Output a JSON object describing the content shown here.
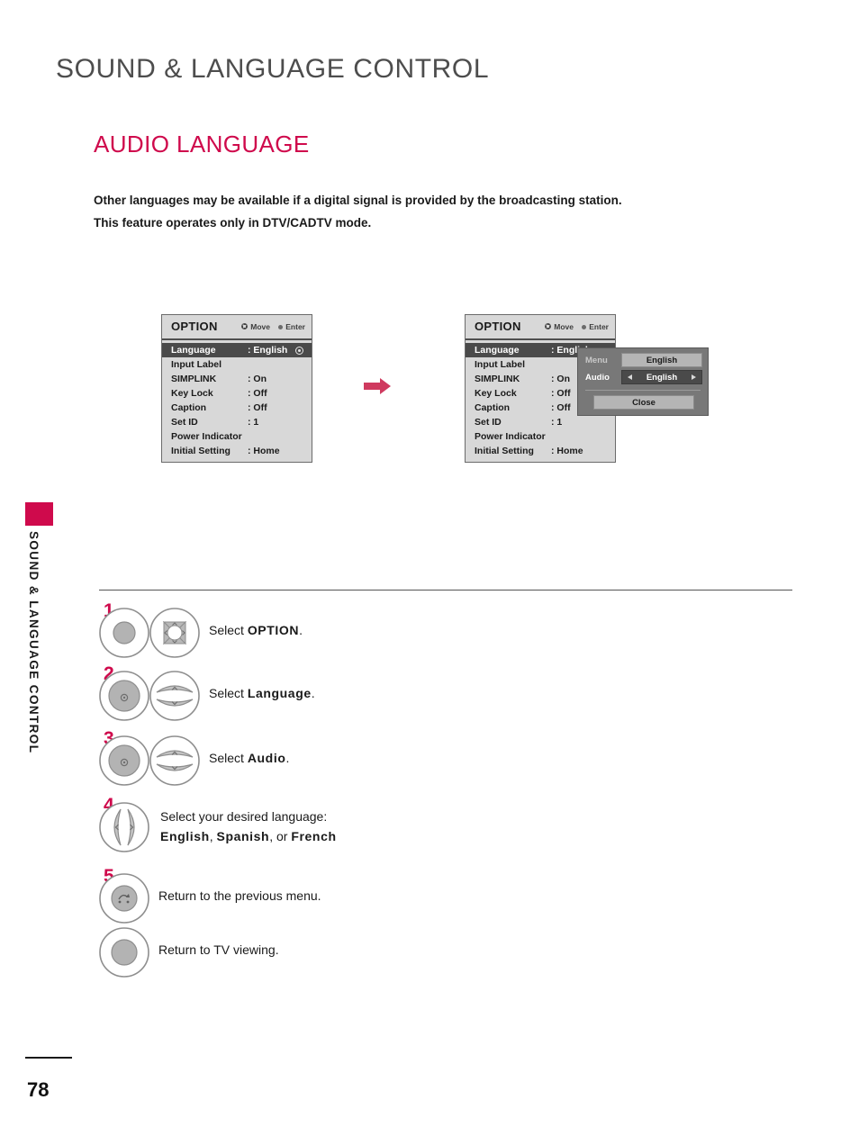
{
  "page": {
    "chapter_title": "SOUND & LANGUAGE CONTROL",
    "section_title": "AUDIO LANGUAGE",
    "intro_line1": "Other languages may be available if a digital signal is provided by the broadcasting station.",
    "intro_line2": "This feature operates only in DTV/CADTV mode.",
    "side_tab_label": "SOUND & LANGUAGE CONTROL",
    "page_number": "78",
    "accent_color": "#cf0a4c",
    "title_color": "#4d4d4d"
  },
  "osd": {
    "title": "OPTION",
    "hint_move": "Move",
    "hint_enter": "Enter",
    "rows": [
      {
        "label": "Language",
        "value": ": English",
        "selected": true
      },
      {
        "label": "Input Label",
        "value": "",
        "selected": false
      },
      {
        "label": "SIMPLINK",
        "value": ": On",
        "selected": false
      },
      {
        "label": "Key Lock",
        "value": ": Off",
        "selected": false
      },
      {
        "label": "Caption",
        "value": ": Off",
        "selected": false
      },
      {
        "label": "Set ID",
        "value": ": 1",
        "selected": false
      },
      {
        "label": "Power Indicator",
        "value": "",
        "selected": false
      },
      {
        "label": "Initial Setting",
        "value": ": Home",
        "selected": false
      }
    ]
  },
  "popup": {
    "menu_label": "Menu",
    "menu_value": "English",
    "audio_label": "Audio",
    "audio_value": "English",
    "close_label": "Close"
  },
  "steps": [
    {
      "number": "1",
      "text_prefix": "Select ",
      "text_bold": "OPTION",
      "text_suffix": "."
    },
    {
      "number": "2",
      "text_prefix": "Select ",
      "text_bold": "Language",
      "text_suffix": "."
    },
    {
      "number": "3",
      "text_prefix": "Select ",
      "text_bold": "Audio",
      "text_suffix": "."
    },
    {
      "number": "4",
      "line1": "Select  your  desired  language:",
      "lang1": "English",
      "sep1": ", ",
      "lang2": "Spanish",
      "sep2": ", or ",
      "lang3": "French"
    },
    {
      "number": "5",
      "text": "Return to the previous menu."
    },
    {
      "number": "",
      "text": "Return to TV viewing."
    }
  ]
}
